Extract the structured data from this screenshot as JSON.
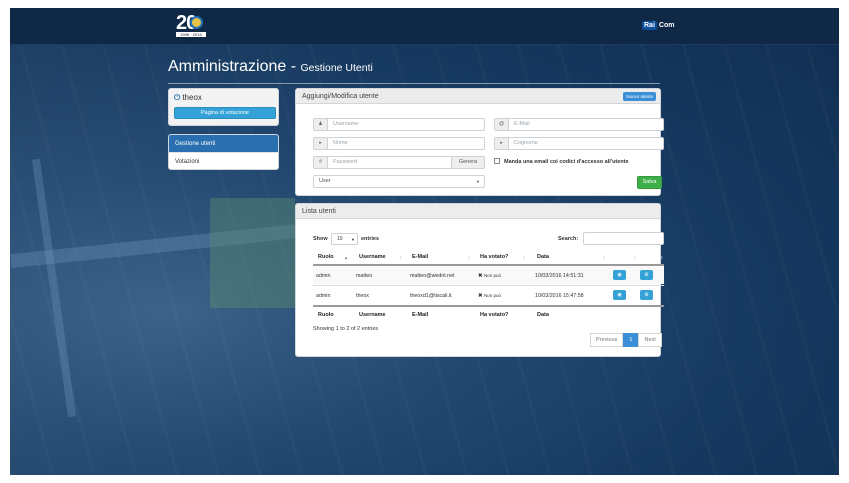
{
  "brand": {
    "logo_number": "20",
    "logo_tagline": "1996 · 2016",
    "rai": "Rai",
    "com": "Com"
  },
  "header": {
    "title": "Amministrazione -",
    "subtitle": "Gestione Utenti"
  },
  "user_panel": {
    "username": "theox",
    "voting_page_button": "Pagina di votazione"
  },
  "nav": {
    "items": [
      {
        "label": "Gestione utenti",
        "active": true
      },
      {
        "label": "Votazioni",
        "active": false
      }
    ]
  },
  "form": {
    "title": "Aggiungi/Modifica utente",
    "new_user_button": "Nuovo utente",
    "username_placeholder": "Username",
    "email_placeholder": "E-Mail",
    "name_placeholder": "Nome",
    "surname_placeholder": "Cognome",
    "password_placeholder": "Password",
    "generate_button": "Genera",
    "send_email_label": "Manda una email coi codici d'accesso all'utente",
    "role_selected": "User",
    "save_button": "Salva"
  },
  "list": {
    "title": "Lista utenti",
    "show_label": "Show",
    "entries_count": "10",
    "entries_label": "entries",
    "search_label": "Search:",
    "columns": [
      "Ruolo",
      "Username",
      "E-Mail",
      "Ha votato?",
      "Data"
    ],
    "rows": [
      {
        "ruolo": "admin",
        "username": "matteo",
        "email": "matteo@wedot.net",
        "voted": "Non può",
        "data": "10/03/2016 14:51:31"
      },
      {
        "ruolo": "admin",
        "username": "theox",
        "email": "theoxd1@tiscali.it",
        "voted": "Non può",
        "data": "10/03/2016 15:47:58"
      }
    ],
    "info": "Showing 1 to 2 of 2 entries",
    "pagination": {
      "previous": "Previous",
      "current": "1",
      "next": "Next"
    }
  }
}
